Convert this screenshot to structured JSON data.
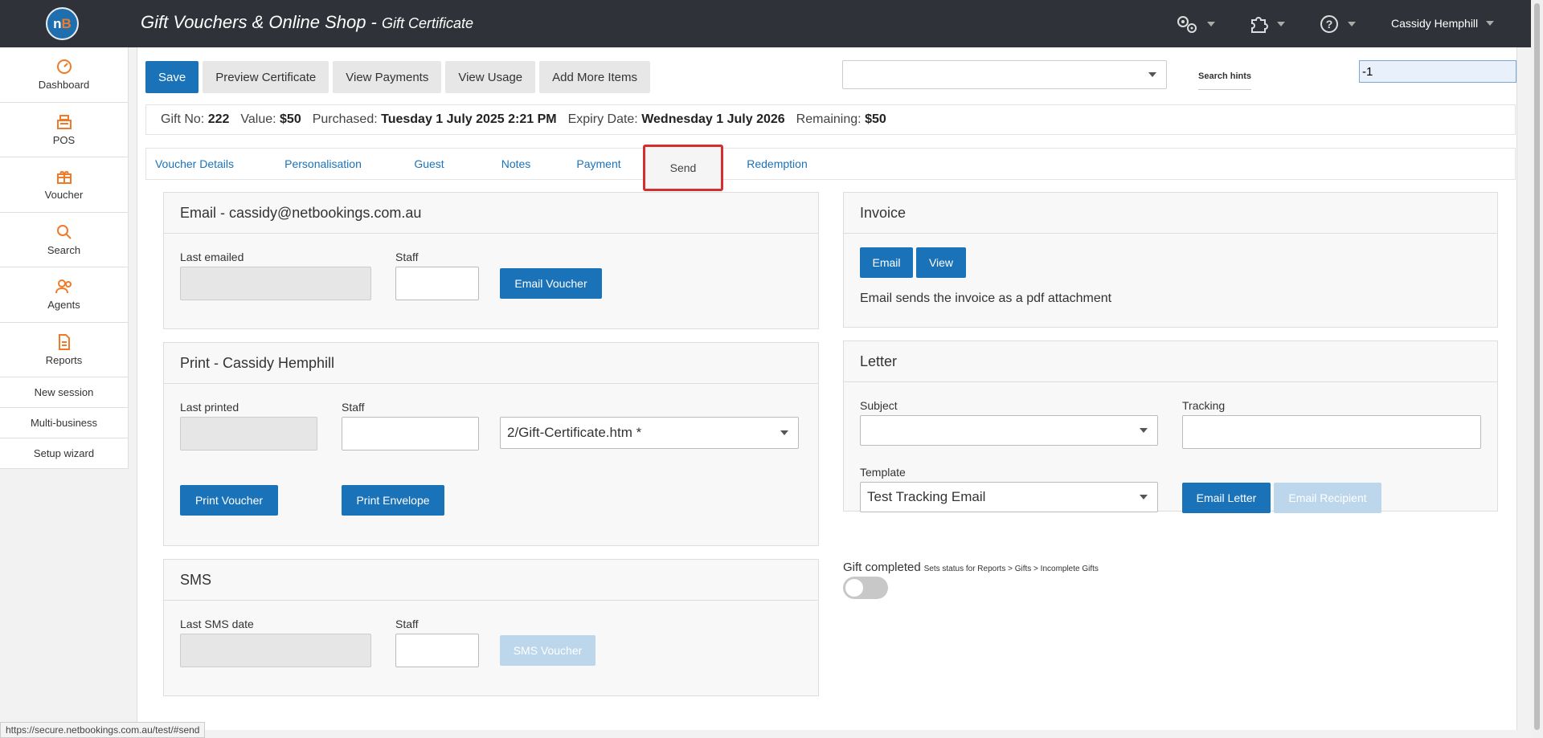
{
  "header": {
    "title": "Gift Vouchers & Online Shop - ",
    "subtitle": "Gift Certificate",
    "user": "Cassidy Hemphill",
    "icons": [
      "settings-gears-icon",
      "puzzle-icon",
      "help-icon"
    ]
  },
  "sidebar": {
    "items": [
      {
        "label": "Dashboard",
        "icon": "dashboard-icon"
      },
      {
        "label": "POS",
        "icon": "cash-register-icon"
      },
      {
        "label": "Voucher",
        "icon": "gift-icon"
      },
      {
        "label": "Search",
        "icon": "search-icon"
      },
      {
        "label": "Agents",
        "icon": "users-icon"
      },
      {
        "label": "Reports",
        "icon": "document-icon"
      }
    ],
    "links": [
      "New session",
      "Multi-business",
      "Setup wizard"
    ]
  },
  "toolbar": {
    "save": "Save",
    "preview": "Preview Certificate",
    "view_payments": "View Payments",
    "view_usage": "View Usage",
    "add_more": "Add More Items",
    "search_hints": "Search hints",
    "search_value": "-1"
  },
  "info": {
    "gift_no_label": "Gift No:",
    "gift_no": "222",
    "value_label": "Value:",
    "value": "$50",
    "purchased_label": "Purchased:",
    "purchased": "Tuesday 1 July 2025 2:21 PM",
    "expiry_label": "Expiry Date:",
    "expiry": "Wednesday 1 July 2026",
    "remaining_label": "Remaining:",
    "remaining": "$50"
  },
  "tabs": [
    "Voucher Details",
    "Personalisation",
    "Guest",
    "Notes",
    "Payment",
    "Send",
    "Redemption"
  ],
  "email": {
    "title": "Email - cassidy@netbookings.com.au",
    "last_label": "Last emailed",
    "staff_label": "Staff",
    "button": "Email Voucher"
  },
  "print": {
    "title": "Print - Cassidy Hemphill",
    "last_label": "Last printed",
    "staff_label": "Staff",
    "template": "2/Gift-Certificate.htm *",
    "print_voucher": "Print Voucher",
    "print_envelope": "Print Envelope"
  },
  "sms": {
    "title": "SMS",
    "last_label": "Last SMS date",
    "staff_label": "Staff",
    "button": "SMS Voucher"
  },
  "invoice": {
    "title": "Invoice",
    "email": "Email",
    "view": "View",
    "note": "Email sends the invoice as a pdf attachment"
  },
  "letter": {
    "title": "Letter",
    "subject_label": "Subject",
    "tracking_label": "Tracking",
    "template_label": "Template",
    "template_value": "Test Tracking Email",
    "email_letter": "Email Letter",
    "email_recipient": "Email Recipient"
  },
  "gift_completed": {
    "label": "Gift completed",
    "hint": "Sets status for Reports > Gifts > Incomplete Gifts",
    "on": false
  },
  "status_url": "https://secure.netbookings.com.au/test/#send",
  "colors": {
    "primary": "#1a73b8",
    "accent": "#f07a28",
    "topbar": "#2f3238",
    "active_tab_border": "#d32f2f"
  }
}
